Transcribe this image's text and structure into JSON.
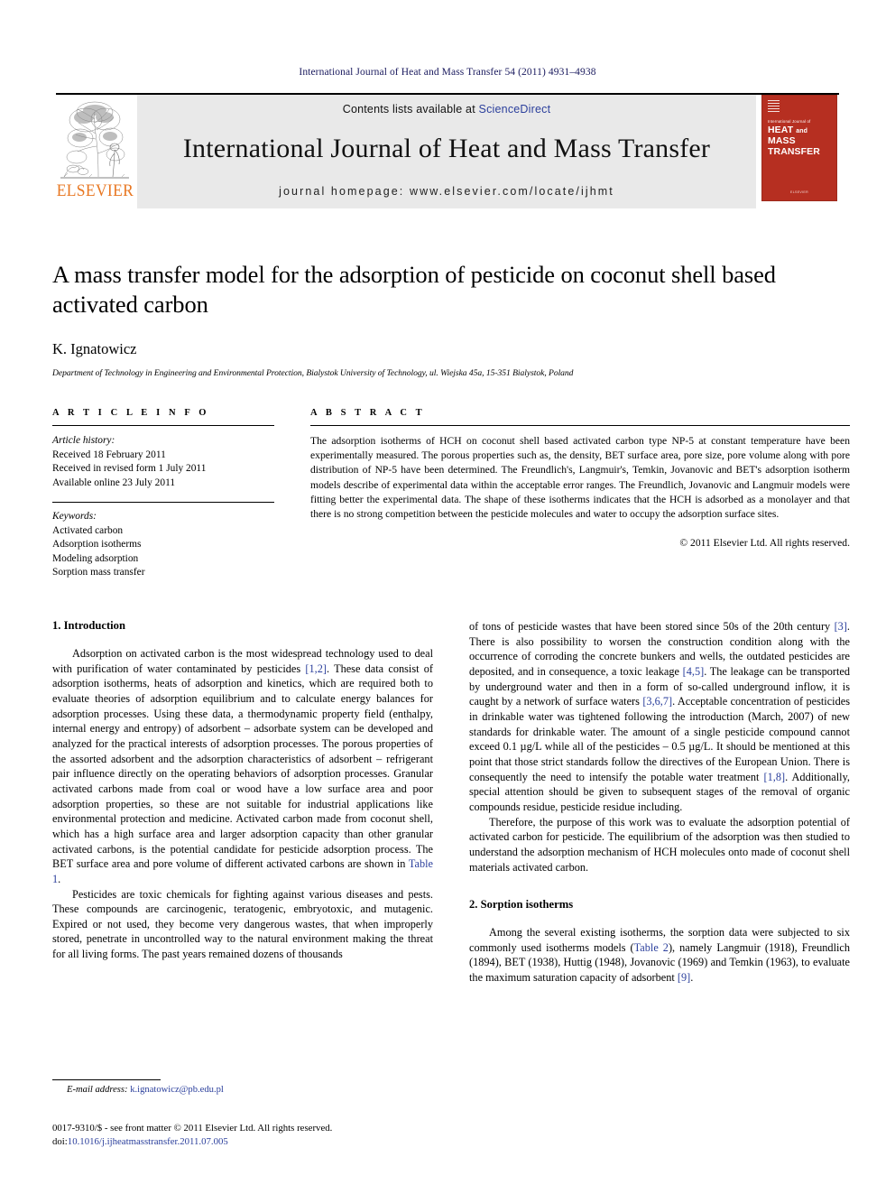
{
  "running_head": "International Journal of Heat and Mass Transfer 54 (2011) 4931–4938",
  "masthead": {
    "contents_prefix": "Contents lists available at ",
    "sciencedirect": "ScienceDirect",
    "journal_title": "International Journal of Heat and Mass Transfer",
    "homepage": "journal homepage: www.elsevier.com/locate/ijhmt",
    "publisher_wordmark": "ELSEVIER",
    "cover": {
      "small_line": "International Journal of",
      "line1": "HEAT",
      "line_and": "and",
      "line1b": "MASS",
      "line2": "TRANSFER",
      "bottom": "ELSEVIER"
    },
    "accent_color": "#E87722",
    "link_color": "#2b3f9c",
    "cover_color": "#b62f21"
  },
  "article": {
    "title": "A mass transfer model for the adsorption of pesticide on coconut shell based activated carbon",
    "author": "K. Ignatowicz",
    "affiliation": "Department of Technology in Engineering and Environmental Protection, Bialystok University of Technology, ul. Wiejska 45a, 15-351 Bialystok, Poland"
  },
  "article_info": {
    "heading": "A R T I C L E   I N F O",
    "history_label": "Article history:",
    "history": [
      "Received 18 February 2011",
      "Received in revised form 1 July 2011",
      "Available online 23 July 2011"
    ],
    "keywords_label": "Keywords:",
    "keywords": [
      "Activated carbon",
      "Adsorption isotherms",
      "Modeling adsorption",
      "Sorption mass transfer"
    ]
  },
  "abstract": {
    "heading": "A B S T R A C T",
    "text": "The adsorption isotherms of HCH on coconut shell based activated carbon type NP-5 at constant temperature have been experimentally measured. The porous properties such as, the density, BET surface area, pore size, pore volume along with pore distribution of NP-5 have been determined. The Freundlich's, Langmuir's, Temkin, Jovanovic and BET's adsorption isotherm models describe of experimental data within the acceptable error ranges. The Freundlich, Jovanovic and Langmuir models were fitting better the experimental data. The shape of these isotherms indicates that the HCH is adsorbed as a monolayer and that there is no strong competition between the pesticide molecules and water to occupy the adsorption surface sites.",
    "copyright": "© 2011 Elsevier Ltd. All rights reserved."
  },
  "sections": {
    "intro_heading": "1. Introduction",
    "intro_p1_a": "Adsorption on activated carbon is the most widespread technology used to deal with purification of water contaminated by pesticides ",
    "intro_p1_ref1": "[1,2]",
    "intro_p1_b": ". These data consist of adsorption isotherms, heats of adsorption and kinetics, which are required both to evaluate theories of adsorption equilibrium and to calculate energy balances for adsorption processes. Using these data, a thermodynamic property field (enthalpy, internal energy and entropy) of adsorbent – adsorbate system can be developed and analyzed for the practical interests of adsorption processes. The porous properties of the assorted adsorbent and the adsorption characteristics of adsorbent – refrigerant pair influence directly on the operating behaviors of adsorption processes. Granular activated carbons made from coal or wood have a low surface area and poor adsorption properties, so these are not suitable for industrial applications like environmental protection and medicine. Activated carbon made from coconut shell, which has a high surface area and larger adsorption capacity than other granular activated carbons, is the potential candidate for pesticide adsorption process. The BET surface area and pore volume of different activated carbons are shown in ",
    "intro_p1_ref2": "Table 1",
    "intro_p1_c": ".",
    "intro_p2": "Pesticides are toxic chemicals for fighting against various diseases and pests. These compounds are carcinogenic, teratogenic, embryotoxic, and mutagenic. Expired or not used, they become very dangerous wastes, that when improperly stored, penetrate in uncontrolled way to the natural environment making the threat for all living forms. The past years remained dozens of thousands",
    "right_p1_a": "of tons of pesticide wastes that have been stored since 50s of the 20th century ",
    "right_p1_ref1": "[3]",
    "right_p1_b": ". There is also possibility to worsen the construction condition along with the occurrence of corroding the concrete bunkers and wells, the outdated pesticides are deposited, and in consequence, a toxic leakage ",
    "right_p1_ref2": "[4,5]",
    "right_p1_c": ". The leakage can be transported by underground water and then in a form of so-called underground inflow, it is caught by a network of surface waters ",
    "right_p1_ref3": "[3,6,7]",
    "right_p1_d": ". Acceptable concentration of pesticides in drinkable water was tightened following the introduction (March, 2007) of new standards for drinkable water. The amount of a single pesticide compound cannot exceed 0.1 µg/L while all of the pesticides – 0.5 µg/L. It should be mentioned at this point that those strict standards follow the directives of the European Union. There is consequently the need to intensify the potable water treatment ",
    "right_p1_ref4": "[1,8]",
    "right_p1_e": ". Additionally, special attention should be given to subsequent stages of the removal of organic compounds residue, pesticide residue including.",
    "right_p2": "Therefore, the purpose of this work was to evaluate the adsorption potential of activated carbon for pesticide. The equilibrium of the adsorption was then studied to understand the adsorption mechanism of HCH molecules onto made of coconut shell materials activated carbon.",
    "sorption_heading": "2. Sorption isotherms",
    "sorption_p1_a": "Among the several existing isotherms, the sorption data were subjected to six commonly used isotherms models (",
    "sorption_p1_ref1": "Table 2",
    "sorption_p1_b": "), namely Langmuir (1918), Freundlich (1894), BET (1938), Huttig (1948), Jovanovic (1969) and Temkin (1963), to evaluate the maximum saturation capacity of adsorbent ",
    "sorption_p1_ref2": "[9]",
    "sorption_p1_c": "."
  },
  "footnote": {
    "label": "E-mail address:",
    "email": "k.ignatowicz@pb.edu.pl"
  },
  "footer": {
    "line1": "0017-9310/$ - see front matter © 2011 Elsevier Ltd. All rights reserved.",
    "doi_label": "doi:",
    "doi_value": "10.1016/j.ijheatmasstransfer.2011.07.005"
  }
}
